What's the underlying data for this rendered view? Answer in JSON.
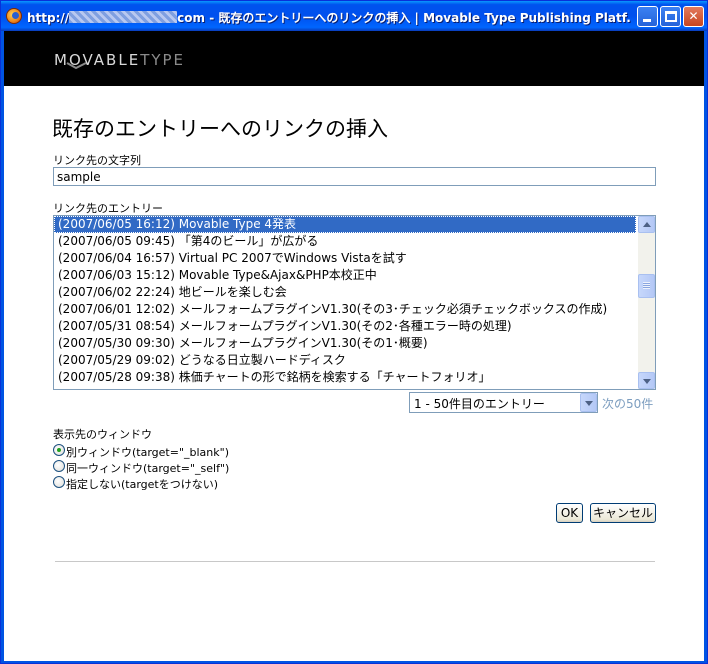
{
  "window": {
    "title_prefix": "http://",
    "title_suffix": "com - 既存のエントリーへのリンクの挿入 | Movable Type Publishing Platf...",
    "minimize_label": "",
    "close_label": "✕"
  },
  "brand": {
    "logo_main": "MOVABLE",
    "logo_sub": "TYPE"
  },
  "page": {
    "heading": "既存のエントリーへのリンクの挿入"
  },
  "link_text": {
    "label": "リンク先の文字列",
    "value": "sample"
  },
  "entries": {
    "label": "リンク先のエントリー",
    "items": [
      {
        "text": "(2007/06/05 16:12) Movable Type 4発表",
        "selected": true
      },
      {
        "text": "(2007/06/05 09:45) 「第4のビール」が広がる",
        "selected": false
      },
      {
        "text": "(2007/06/04 16:57) Virtual PC 2007でWindows Vistaを試す",
        "selected": false
      },
      {
        "text": "(2007/06/03 15:12) Movable Type&Ajax&PHP本校正中",
        "selected": false
      },
      {
        "text": "(2007/06/02 22:24) 地ビールを楽しむ会",
        "selected": false
      },
      {
        "text": "(2007/06/01 12:02) メールフォームプラグインV1.30(その3･チェック必須チェックボックスの作成)",
        "selected": false
      },
      {
        "text": "(2007/05/31 08:54) メールフォームプラグインV1.30(その2･各種エラー時の処理)",
        "selected": false
      },
      {
        "text": "(2007/05/30 09:30) メールフォームプラグインV1.30(その1･概要)",
        "selected": false
      },
      {
        "text": "(2007/05/29 09:02) どうなる日立製ハードディスク",
        "selected": false
      },
      {
        "text": "(2007/05/28 09:38) 株価チャートの形で銘柄を検索する「チャートフォリオ」",
        "selected": false
      }
    ]
  },
  "pager": {
    "selected_option": "1 - 50件目のエントリー",
    "next_label": "次の50件"
  },
  "target": {
    "label": "表示先のウィンドウ",
    "options": [
      {
        "label": "別ウィンドウ(target=\"_blank\")",
        "checked": true
      },
      {
        "label": "同一ウィンドウ(target=\"_self\")",
        "checked": false
      },
      {
        "label": "指定しない(targetをつけない)",
        "checked": false
      }
    ]
  },
  "actions": {
    "ok_label": "OK",
    "cancel_label": "キャンセル"
  },
  "colors": {
    "selection": "#316ac5",
    "next_link": "#7d9ec0",
    "brand_bar": "#000000"
  }
}
